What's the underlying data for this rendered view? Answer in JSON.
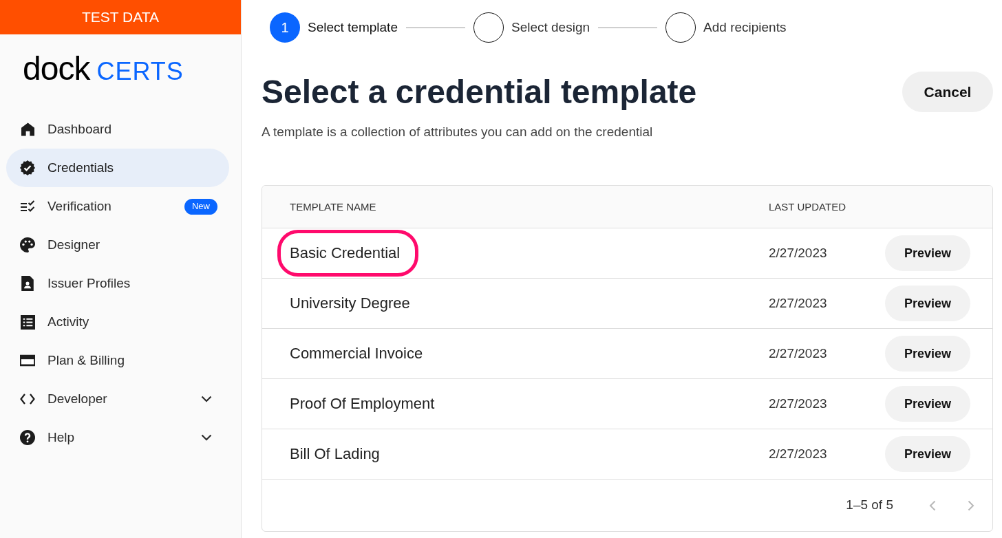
{
  "sidebar": {
    "banner": "TEST DATA",
    "logo": {
      "wordmark": "dock",
      "product": "CERTS"
    },
    "items": [
      {
        "label": "Dashboard",
        "selected": false
      },
      {
        "label": "Credentials",
        "selected": true
      },
      {
        "label": "Verification",
        "selected": false,
        "badge": "New"
      },
      {
        "label": "Designer",
        "selected": false
      },
      {
        "label": "Issuer Profiles",
        "selected": false
      },
      {
        "label": "Activity",
        "selected": false
      },
      {
        "label": "Plan & Billing",
        "selected": false
      },
      {
        "label": "Developer",
        "selected": false,
        "expanded": false
      },
      {
        "label": "Help",
        "selected": false,
        "expanded": false
      }
    ]
  },
  "stepper": {
    "steps": [
      {
        "number": "1",
        "label": "Select template",
        "selected": true
      },
      {
        "label": "Select design",
        "selected": false
      },
      {
        "label": "Add recipients",
        "selected": false
      }
    ]
  },
  "header": {
    "title": "Select a credential template",
    "subtitle": "A template is a collection of attributes you can add on the credential",
    "cancel_button": "Cancel"
  },
  "table": {
    "columns": [
      "TEMPLATE NAME",
      "LAST UPDATED"
    ],
    "rows": [
      {
        "name": "Basic Credential",
        "last_updated": "2/27/2023",
        "action": "Preview",
        "highlighted": true
      },
      {
        "name": "University Degree",
        "last_updated": "2/27/2023",
        "action": "Preview",
        "highlighted": false
      },
      {
        "name": "Commercial Invoice",
        "last_updated": "2/27/2023",
        "action": "Preview",
        "highlighted": false
      },
      {
        "name": "Proof Of Employment",
        "last_updated": "2/27/2023",
        "action": "Preview",
        "highlighted": false
      },
      {
        "name": "Bill Of Lading",
        "last_updated": "2/27/2023",
        "action": "Preview",
        "highlighted": false
      }
    ],
    "pagination": {
      "range": "1–5 of 5",
      "prev_disabled": true,
      "next_disabled": true
    }
  }
}
